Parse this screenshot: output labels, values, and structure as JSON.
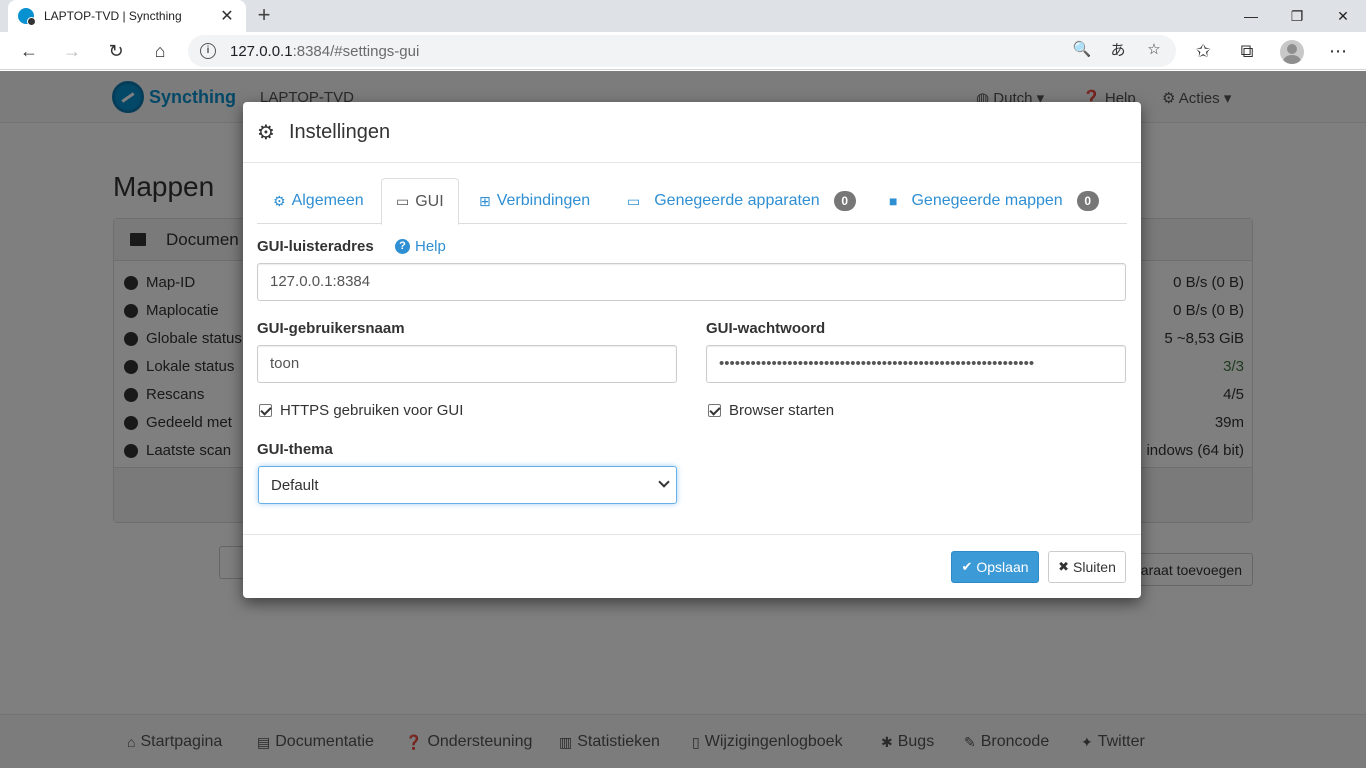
{
  "browser": {
    "tab_title": "LAPTOP-TVD | Syncthing",
    "url_host": "127.0.0.1",
    "url_rest": ":8384/#settings-gui"
  },
  "navbar": {
    "brand": "Syncthing",
    "device": "LAPTOP-TVD",
    "language": "Dutch",
    "help": "Help",
    "actions": "Acties"
  },
  "page": {
    "title": "Mappen",
    "panel_heading": "Documen",
    "rows": [
      {
        "label": "Map-ID",
        "value": "0 B/s (0 B)"
      },
      {
        "label": "Maplocatie",
        "value": "0 B/s (0 B)"
      },
      {
        "label": "Globale status",
        "value": "5   ~8,53 GiB"
      },
      {
        "label": "Lokale status",
        "value": "3/3"
      },
      {
        "label": "Rescans",
        "value": "4/5"
      },
      {
        "label": "Gedeeld met",
        "value": "39m"
      },
      {
        "label": "Laatste scan",
        "value": "indows (64 bit)"
      }
    ],
    "add_device": "araat toevoegen"
  },
  "footer": {
    "links": [
      "Startpagina",
      "Documentatie",
      "Ondersteuning",
      "Statistieken",
      "Wijzigingenlogboek",
      "Bugs",
      "Broncode",
      "Twitter"
    ]
  },
  "modal": {
    "title": "Instellingen",
    "tabs": [
      {
        "label": "Algemeen"
      },
      {
        "label": "GUI"
      },
      {
        "label": "Verbindingen"
      },
      {
        "label": "Genegeerde apparaten",
        "badge": "0"
      },
      {
        "label": "Genegeerde mappen",
        "badge": "0"
      }
    ],
    "listen_label": "GUI-luisteradres",
    "help": "Help",
    "listen_value": "127.0.0.1:8384",
    "user_label": "GUI-gebruikersnaam",
    "user_value": "toon",
    "pw_label": "GUI-wachtwoord",
    "pw_value": "••••••••••••••••••••••••••••••••••••••••••••••••••••••••••••",
    "https_label": "HTTPS gebruiken voor GUI",
    "browser_label": "Browser starten",
    "theme_label": "GUI-thema",
    "theme_value": "Default",
    "save": "Opslaan",
    "close": "Sluiten"
  },
  "colors": {
    "accent": "#2f8fd3",
    "primary_button": "#3c9ad7",
    "badge": "#777777"
  }
}
